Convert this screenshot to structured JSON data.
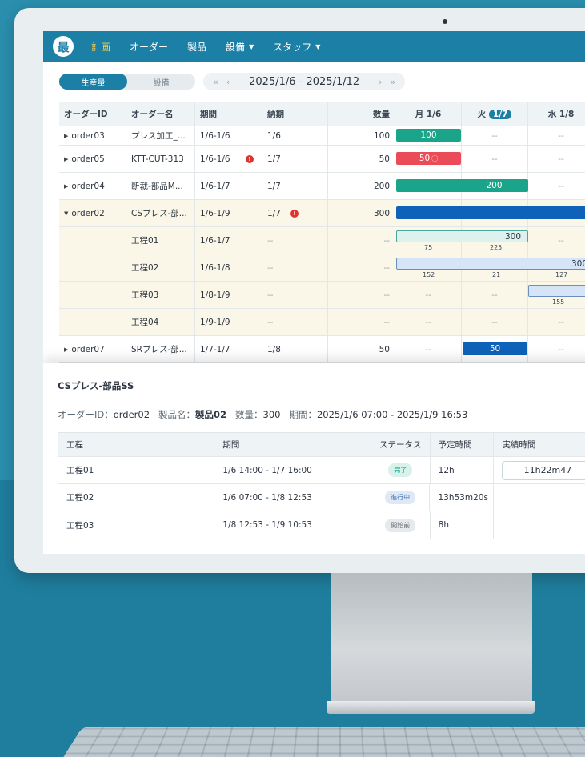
{
  "nav": {
    "logo": "最",
    "items": [
      {
        "label": "計画",
        "active": true,
        "dropdown": false
      },
      {
        "label": "オーダー",
        "active": false,
        "dropdown": false
      },
      {
        "label": "製品",
        "active": false,
        "dropdown": false
      },
      {
        "label": "設備",
        "active": false,
        "dropdown": true
      },
      {
        "label": "スタッフ",
        "active": false,
        "dropdown": true
      }
    ]
  },
  "toolbar": {
    "tabs": [
      "生産量",
      "設備"
    ],
    "prev_week": "«",
    "prev_day": "‹",
    "date_range": "2025/1/6 - 2025/1/12",
    "next_day": "›",
    "next_week": "»"
  },
  "grid": {
    "headers": {
      "order_id": "オーダーID",
      "order_name": "オーダー名",
      "period": "期間",
      "deadline": "納期",
      "quantity": "数量",
      "mon_day": "月",
      "mon_date": "1/6",
      "tue_day": "火",
      "tue_date": "1/7",
      "wed_day": "水",
      "wed_date": "1/8"
    },
    "empty": "--",
    "rows": {
      "r1": {
        "id": "order03",
        "name": "プレス加工_...",
        "period": "1/6-1/6",
        "deadline": "1/6",
        "qty": "100",
        "bar": "100"
      },
      "r2": {
        "id": "order05",
        "name": "KTT-CUT-313",
        "period": "1/6-1/6",
        "deadline": "1/7",
        "qty": "50",
        "bar": "50"
      },
      "r3": {
        "id": "order04",
        "name": "断裁-部品M...",
        "period": "1/6-1/7",
        "deadline": "1/7",
        "qty": "200",
        "bar": "200"
      },
      "r4": {
        "id": "order02",
        "name": "CSプレス-部...",
        "period": "1/6-1/9",
        "deadline": "1/7",
        "qty": "300"
      },
      "s1": {
        "name": "工程01",
        "period": "1/6-1/7",
        "deadline": "--",
        "qty": "--",
        "bar": "300",
        "v1": "75",
        "v2": "225"
      },
      "s2": {
        "name": "工程02",
        "period": "1/6-1/8",
        "deadline": "--",
        "qty": "--",
        "bar": "300",
        "v1": "152",
        "v2": "21",
        "v3": "127"
      },
      "s3": {
        "name": "工程03",
        "period": "1/8-1/9",
        "deadline": "--",
        "qty": "--",
        "v3": "155"
      },
      "s4": {
        "name": "工程04",
        "period": "1/9-1/9",
        "deadline": "--",
        "qty": "--"
      },
      "r5": {
        "id": "order07",
        "name": "SRプレス-部...",
        "period": "1/7-1/7",
        "deadline": "1/8",
        "qty": "50",
        "bar": "50"
      }
    }
  },
  "detail": {
    "title": "CSプレス-部品SS",
    "meta": {
      "order_id_label": "オーダーID：",
      "order_id": "order02",
      "product_label": "製品名：",
      "product": "製品02",
      "qty_label": "数量：",
      "qty": "300",
      "period_label": "期間：",
      "period": "2025/1/6 07:00 - 2025/1/9 16:53"
    },
    "headers": {
      "process": "工程",
      "period": "期間",
      "status": "ステータス",
      "planned": "予定時間",
      "actual": "実績時間"
    },
    "rows": [
      {
        "process": "工程01",
        "period": "1/6 14:00 - 1/7 16:00",
        "status": "完了",
        "planned": "12h",
        "actual": "11h22m47"
      },
      {
        "process": "工程02",
        "period": "1/6 07:00 - 1/8 12:53",
        "status": "進行中",
        "planned": "13h53m20s",
        "actual": ""
      },
      {
        "process": "工程03",
        "period": "1/8 12:53 - 1/9 10:53",
        "status": "開始前",
        "planned": "8h",
        "actual": ""
      }
    ]
  }
}
